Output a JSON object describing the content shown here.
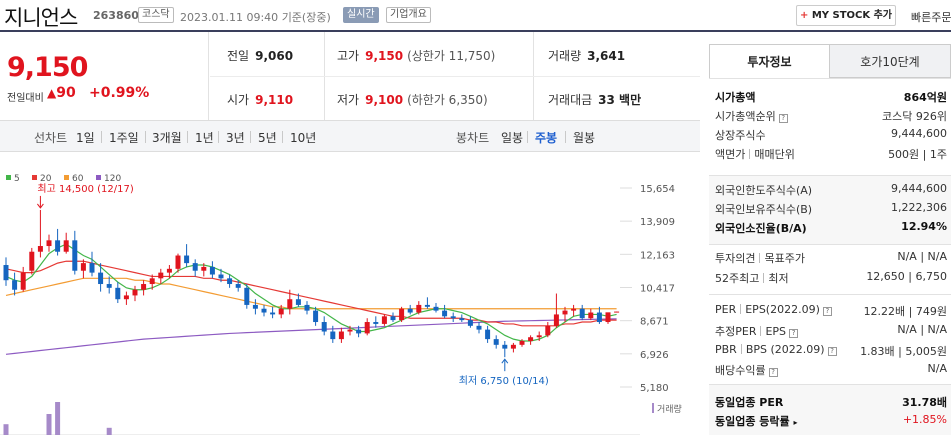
{
  "header": {
    "company": "지니언스",
    "code": "263860",
    "market": "코스닥",
    "datetime": "2023.01.11 09:40",
    "basis": "기준(장중)",
    "realtime": "실시간",
    "overview": "기업개요",
    "mystock": "MY STOCK 추가",
    "mystock_plus": "+",
    "quick_order": "빠른주문"
  },
  "price": {
    "current": "9,150",
    "change_label": "전일대비",
    "change_arrow": "▲",
    "change": "90",
    "change_pct": "+0.99%",
    "up_color": "#e0141e"
  },
  "stats": {
    "prev_label": "전일",
    "prev": "9,060",
    "high_label": "고가",
    "high": "9,150",
    "upper_limit": "(상한가 11,750)",
    "volume_label": "거래량",
    "volume": "3,641",
    "open_label": "시가",
    "open": "9,110",
    "low_label": "저가",
    "low": "9,100",
    "lower_limit": "(하한가 6,350)",
    "amount_label": "거래대금",
    "amount": "33 백만"
  },
  "toolbar": {
    "line_label": "선차트",
    "line_opts": [
      "1일",
      "1주일",
      "3개월",
      "1년",
      "3년",
      "5년",
      "10년"
    ],
    "candle_label": "봉차트",
    "candle_opts": [
      "일봉",
      "주봉",
      "월봉"
    ],
    "candle_active": "주봉"
  },
  "chart_data": {
    "type": "candlestick",
    "legend": [
      {
        "name": "5",
        "color": "#43b649"
      },
      {
        "name": "20",
        "color": "#e53935"
      },
      {
        "name": "60",
        "color": "#f39c33"
      },
      {
        "name": "120",
        "color": "#8d5bc2"
      }
    ],
    "y_ticks": [
      "15,654",
      "13,909",
      "12,163",
      "10,417",
      "8,671",
      "6,926",
      "5,180"
    ],
    "ylim": [
      5180,
      15654
    ],
    "high_annotation": "최고 14,500 (12/17)",
    "low_annotation": "최저 6,750 (10/14)",
    "volume_label": "거래량",
    "candles": [
      {
        "o": 11600,
        "h": 12000,
        "l": 10500,
        "c": 10800
      },
      {
        "o": 10800,
        "h": 11200,
        "l": 10000,
        "c": 10300
      },
      {
        "o": 10300,
        "h": 11500,
        "l": 10200,
        "c": 11200
      },
      {
        "o": 11300,
        "h": 12500,
        "l": 11100,
        "c": 12300
      },
      {
        "o": 12300,
        "h": 14500,
        "l": 12000,
        "c": 12600
      },
      {
        "o": 12600,
        "h": 13200,
        "l": 12300,
        "c": 12900
      },
      {
        "o": 12900,
        "h": 13500,
        "l": 12100,
        "c": 12300
      },
      {
        "o": 12300,
        "h": 13300,
        "l": 12200,
        "c": 12900
      },
      {
        "o": 12900,
        "h": 13400,
        "l": 11100,
        "c": 11300
      },
      {
        "o": 11300,
        "h": 11900,
        "l": 10900,
        "c": 11700
      },
      {
        "o": 11700,
        "h": 12300,
        "l": 11000,
        "c": 11200
      },
      {
        "o": 11200,
        "h": 11700,
        "l": 10200,
        "c": 10600
      },
      {
        "o": 10600,
        "h": 11000,
        "l": 10100,
        "c": 10400
      },
      {
        "o": 10400,
        "h": 10700,
        "l": 9600,
        "c": 9800
      },
      {
        "o": 9800,
        "h": 10200,
        "l": 9500,
        "c": 10000
      },
      {
        "o": 10000,
        "h": 10500,
        "l": 9700,
        "c": 10300
      },
      {
        "o": 10300,
        "h": 10800,
        "l": 10000,
        "c": 10600
      },
      {
        "o": 10600,
        "h": 11100,
        "l": 10300,
        "c": 10900
      },
      {
        "o": 10900,
        "h": 11400,
        "l": 10600,
        "c": 11200
      },
      {
        "o": 11200,
        "h": 11600,
        "l": 10900,
        "c": 11400
      },
      {
        "o": 11400,
        "h": 12200,
        "l": 11200,
        "c": 12100
      },
      {
        "o": 12100,
        "h": 12700,
        "l": 11500,
        "c": 11700
      },
      {
        "o": 11700,
        "h": 11900,
        "l": 11000,
        "c": 11300
      },
      {
        "o": 11300,
        "h": 11700,
        "l": 11000,
        "c": 11500
      },
      {
        "o": 11500,
        "h": 11800,
        "l": 10900,
        "c": 11100
      },
      {
        "o": 11100,
        "h": 11400,
        "l": 10700,
        "c": 10900
      },
      {
        "o": 10900,
        "h": 11100,
        "l": 10400,
        "c": 10600
      },
      {
        "o": 10600,
        "h": 10800,
        "l": 10200,
        "c": 10400
      },
      {
        "o": 10400,
        "h": 10600,
        "l": 9300,
        "c": 9500
      },
      {
        "o": 9500,
        "h": 9800,
        "l": 9000,
        "c": 9300
      },
      {
        "o": 9300,
        "h": 9500,
        "l": 8900,
        "c": 9100
      },
      {
        "o": 9100,
        "h": 9400,
        "l": 8800,
        "c": 9000
      },
      {
        "o": 9000,
        "h": 9500,
        "l": 8800,
        "c": 9300
      },
      {
        "o": 9300,
        "h": 10300,
        "l": 9000,
        "c": 9800
      },
      {
        "o": 9800,
        "h": 10100,
        "l": 9400,
        "c": 9500
      },
      {
        "o": 9500,
        "h": 9700,
        "l": 9000,
        "c": 9200
      },
      {
        "o": 9200,
        "h": 9400,
        "l": 8400,
        "c": 8600
      },
      {
        "o": 8600,
        "h": 8900,
        "l": 7900,
        "c": 8100
      },
      {
        "o": 8100,
        "h": 8400,
        "l": 7500,
        "c": 7700
      },
      {
        "o": 7700,
        "h": 8300,
        "l": 7500,
        "c": 8100
      },
      {
        "o": 8100,
        "h": 8400,
        "l": 7900,
        "c": 8200
      },
      {
        "o": 8200,
        "h": 8400,
        "l": 7800,
        "c": 8000
      },
      {
        "o": 8000,
        "h": 8800,
        "l": 7900,
        "c": 8600
      },
      {
        "o": 8600,
        "h": 8900,
        "l": 8300,
        "c": 8500
      },
      {
        "o": 8500,
        "h": 9000,
        "l": 8400,
        "c": 8900
      },
      {
        "o": 8900,
        "h": 9100,
        "l": 8600,
        "c": 8700
      },
      {
        "o": 8700,
        "h": 9400,
        "l": 8600,
        "c": 9300
      },
      {
        "o": 9300,
        "h": 9500,
        "l": 9000,
        "c": 9100
      },
      {
        "o": 9100,
        "h": 9700,
        "l": 9000,
        "c": 9500
      },
      {
        "o": 9500,
        "h": 9900,
        "l": 9300,
        "c": 9400
      },
      {
        "o": 9400,
        "h": 9600,
        "l": 9100,
        "c": 9200
      },
      {
        "o": 9200,
        "h": 9500,
        "l": 8800,
        "c": 8900
      },
      {
        "o": 8900,
        "h": 9100,
        "l": 8600,
        "c": 8800
      },
      {
        "o": 8800,
        "h": 9000,
        "l": 8600,
        "c": 8700
      },
      {
        "o": 8700,
        "h": 8900,
        "l": 8300,
        "c": 8400
      },
      {
        "o": 8400,
        "h": 8600,
        "l": 8000,
        "c": 8200
      },
      {
        "o": 8200,
        "h": 8400,
        "l": 7500,
        "c": 7700
      },
      {
        "o": 7700,
        "h": 7900,
        "l": 7200,
        "c": 7400
      },
      {
        "o": 7400,
        "h": 7600,
        "l": 6750,
        "c": 7200
      },
      {
        "o": 7200,
        "h": 7500,
        "l": 7000,
        "c": 7400
      },
      {
        "o": 7400,
        "h": 7700,
        "l": 7300,
        "c": 7600
      },
      {
        "o": 7600,
        "h": 7900,
        "l": 7400,
        "c": 7800
      },
      {
        "o": 7800,
        "h": 8100,
        "l": 7600,
        "c": 7900
      },
      {
        "o": 7900,
        "h": 8600,
        "l": 7800,
        "c": 8400
      },
      {
        "o": 8400,
        "h": 10100,
        "l": 8300,
        "c": 9000
      },
      {
        "o": 9000,
        "h": 9400,
        "l": 8600,
        "c": 9200
      },
      {
        "o": 9200,
        "h": 9500,
        "l": 8900,
        "c": 9300
      },
      {
        "o": 9300,
        "h": 9500,
        "l": 8700,
        "c": 8800
      },
      {
        "o": 8800,
        "h": 9300,
        "l": 8700,
        "c": 9100
      },
      {
        "o": 9100,
        "h": 9400,
        "l": 8500,
        "c": 8600
      },
      {
        "o": 8600,
        "h": 9000,
        "l": 8500,
        "c": 9110
      },
      {
        "o": 9110,
        "h": 9150,
        "l": 9100,
        "c": 9150
      }
    ],
    "ma5": [
      11000,
      10800,
      10700,
      11000,
      11600,
      12200,
      12500,
      12700,
      12400,
      12100,
      11900,
      11500,
      11100,
      10700,
      10400,
      10300,
      10300,
      10400,
      10600,
      10900,
      11300,
      11500,
      11600,
      11600,
      11500,
      11300,
      11100,
      10800,
      10500,
      10100,
      9800,
      9500,
      9300,
      9300,
      9400,
      9400,
      9300,
      9100,
      8800,
      8500,
      8300,
      8100,
      8100,
      8200,
      8300,
      8500,
      8700,
      8900,
      9100,
      9200,
      9300,
      9300,
      9200,
      9100,
      8900,
      8700,
      8500,
      8200,
      7900,
      7700,
      7600,
      7600,
      7700,
      7900,
      8300,
      8600,
      8900,
      9000,
      9000,
      9000,
      8900,
      9000
    ],
    "ma20": [
      11400,
      11300,
      11200,
      11200,
      11300,
      11500,
      11700,
      11800,
      11800,
      11800,
      11700,
      11600,
      11500,
      11400,
      11300,
      11200,
      11100,
      11000,
      11000,
      11000,
      11000,
      11000,
      11000,
      10900,
      10900,
      10800,
      10800,
      10700,
      10600,
      10500,
      10400,
      10300,
      10200,
      10100,
      10000,
      9900,
      9800,
      9700,
      9600,
      9500,
      9400,
      9300,
      9200,
      9100,
      9000,
      8900,
      8900,
      8800,
      8800,
      8800,
      8800,
      8800,
      8800,
      8800,
      8700,
      8700,
      8600,
      8600,
      8500,
      8500,
      8400,
      8400,
      8400,
      8400,
      8400,
      8500,
      8500,
      8600,
      8600,
      8700,
      8700,
      8700
    ],
    "ma60": [
      10000,
      10100,
      10200,
      10300,
      10400,
      10500,
      10600,
      10700,
      10800,
      10900,
      10900,
      10900,
      10900,
      10900,
      10900,
      10800,
      10800,
      10700,
      10600,
      10600,
      10500,
      10400,
      10300,
      10200,
      10100,
      10000,
      9900,
      9800,
      9700,
      9600,
      9500,
      9400,
      9400,
      9300,
      9300,
      9300,
      9300,
      9300,
      9300,
      9300,
      9300,
      9300,
      9300,
      9300,
      9300,
      9300,
      9300,
      9300,
      9300,
      9300,
      9300,
      9300,
      9300,
      9300,
      9300,
      9300,
      9300,
      9300,
      9300,
      9300,
      9300,
      9300,
      9300,
      9300,
      9300,
      9300,
      9300,
      9300,
      9300,
      9300,
      9300,
      9300
    ],
    "ma120": [
      6900,
      6950,
      7000,
      7050,
      7100,
      7150,
      7200,
      7250,
      7300,
      7350,
      7400,
      7450,
      7500,
      7550,
      7600,
      7650,
      7700,
      7730,
      7760,
      7790,
      7820,
      7850,
      7880,
      7910,
      7940,
      7970,
      8000,
      8020,
      8040,
      8060,
      8080,
      8100,
      8120,
      8140,
      8160,
      8180,
      8200,
      8220,
      8240,
      8260,
      8280,
      8300,
      8320,
      8340,
      8360,
      8380,
      8400,
      8420,
      8440,
      8460,
      8480,
      8500,
      8520,
      8540,
      8560,
      8580,
      8600,
      8620,
      8640,
      8650,
      8660,
      8670,
      8680,
      8690,
      8700,
      8710,
      8720,
      8730,
      8740,
      8750,
      8760,
      8770
    ],
    "volume": [
      0,
      0,
      0,
      0,
      0,
      0,
      1,
      0,
      0,
      0,
      0,
      0,
      0,
      0,
      0,
      0,
      0,
      0,
      0,
      0,
      0,
      0,
      0,
      0,
      0,
      0,
      0,
      0,
      0,
      0,
      0,
      0,
      0,
      0,
      0,
      0,
      0,
      0,
      0,
      0,
      0,
      0,
      0,
      0,
      0,
      0,
      0,
      0,
      0,
      0,
      0,
      0,
      0,
      0,
      0,
      0,
      0,
      0,
      0,
      0,
      0,
      0,
      0,
      0,
      0,
      0,
      0,
      0,
      0,
      0,
      0,
      0
    ],
    "volume_bars": [
      {
        "i": 0,
        "v": 0.18
      },
      {
        "i": 5,
        "v": 0.35
      },
      {
        "i": 6,
        "v": 0.55
      },
      {
        "i": 12,
        "v": 0.12
      }
    ]
  },
  "right": {
    "tabs": [
      "투자정보",
      "호가10단계"
    ],
    "market_cap_label": "시가총액",
    "market_cap": "864억원",
    "rank_label": "시가총액순위",
    "rank": "코스닥 926위",
    "shares_label": "상장주식수",
    "shares": "9,444,600",
    "par_label": "액면가",
    "unit_label": "매매단위",
    "par_unit": "500원 | 1주",
    "foreign_limit_label": "외국인한도주식수(A)",
    "foreign_limit": "9,444,600",
    "foreign_hold_label": "외국인보유주식수(B)",
    "foreign_hold": "1,222,306",
    "foreign_rate_label": "외국인소진율(B/A)",
    "foreign_rate": "12.94%",
    "opinion_label": "투자의견",
    "target_label": "목표주가",
    "opinion_target": "N/A | N/A",
    "week52_label": "52주최고",
    "week52_low_label": "최저",
    "week52": "12,650 | 6,750",
    "per_label": "PER",
    "eps_label": "EPS(2022.09)",
    "per_eps": "12.22배 | 749원",
    "est_per_label": "추정PER",
    "est_eps_label": "EPS",
    "est_per_eps": "N/A | N/A",
    "pbr_label": "PBR",
    "bps_label": "BPS (2022.09)",
    "pbr_bps": "1.83배 | 5,005원",
    "div_label": "배당수익률",
    "div": "N/A",
    "ind_per_label": "동일업종 PER",
    "ind_per": "31.78배",
    "ind_rate_label": "동일업종 등락률",
    "ind_rate": "+1.85%"
  }
}
